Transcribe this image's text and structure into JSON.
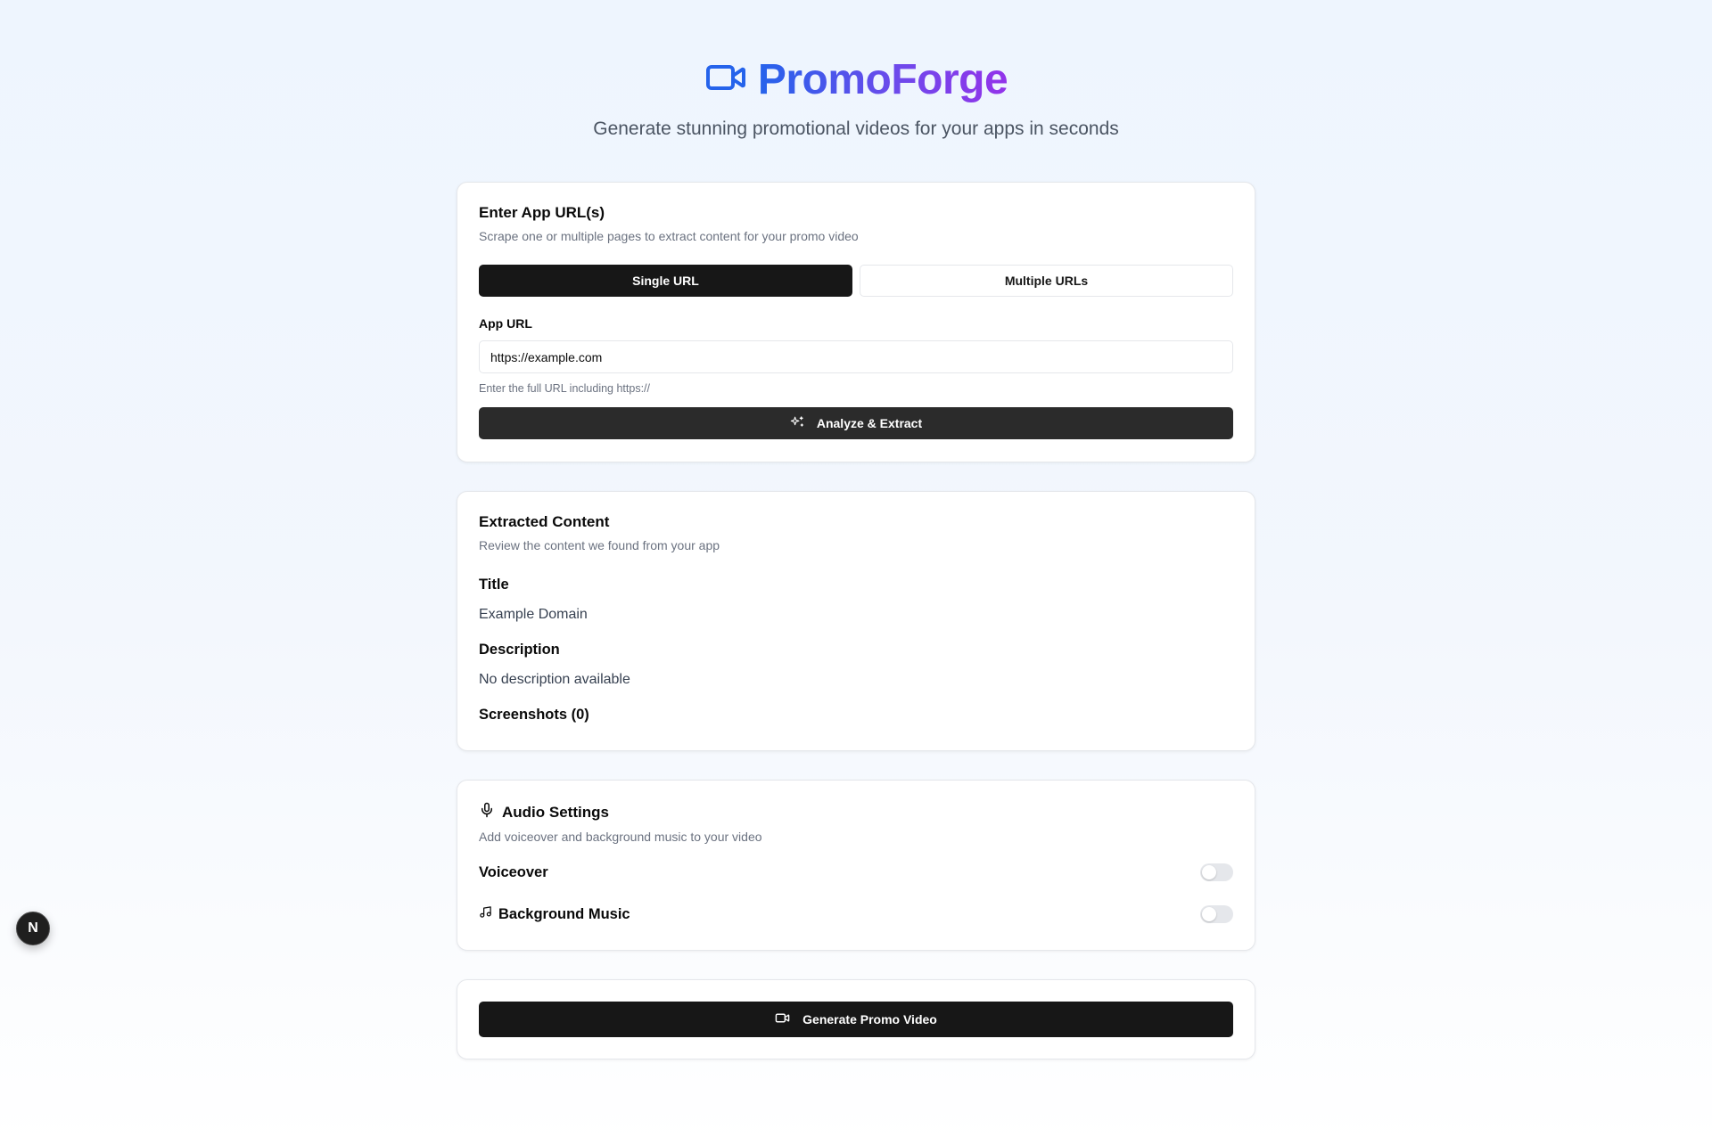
{
  "header": {
    "brand_name": "PromoForge",
    "tagline": "Generate stunning promotional videos for your apps in seconds",
    "brand_icon": "video-camera-icon"
  },
  "url_card": {
    "title": "Enter App URL(s)",
    "subtitle": "Scrape one or multiple pages to extract content for your promo video",
    "tabs": [
      {
        "label": "Single URL",
        "active": true
      },
      {
        "label": "Multiple URLs",
        "active": false
      }
    ],
    "field_label": "App URL",
    "url_value": "https://example.com",
    "hint": "Enter the full URL including https://",
    "analyze_label": "Analyze & Extract"
  },
  "extracted_card": {
    "title": "Extracted Content",
    "subtitle": "Review the content we found from your app",
    "title_label": "Title",
    "title_value": "Example Domain",
    "description_label": "Description",
    "description_value": "No description available",
    "screenshots_label": "Screenshots (0)"
  },
  "audio_card": {
    "title": "Audio Settings",
    "subtitle": "Add voiceover and background music to your video",
    "voiceover_label": "Voiceover",
    "voiceover_enabled": false,
    "music_label": "Background Music",
    "music_enabled": false
  },
  "generate_card": {
    "button_label": "Generate Promo Video"
  },
  "next_badge": {
    "letter": "N"
  },
  "colors": {
    "brand_start": "#2563eb",
    "brand_end": "#9333ea",
    "primary_button": "#171717"
  }
}
